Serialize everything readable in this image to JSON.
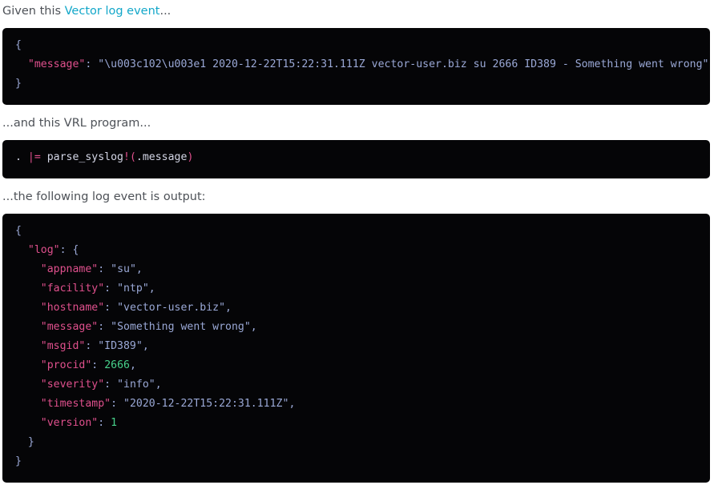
{
  "intro": {
    "prefix": "Given this ",
    "link": "Vector log event",
    "suffix": "..."
  },
  "input_event": {
    "open": "{",
    "key": "\"message\"",
    "colon": ": ",
    "value": "\"\\u003c102\\u003e1 2020-12-22T15:22:31.111Z vector-user.biz su 2666 ID389 - Something went wrong\"",
    "close": "}"
  },
  "program_intro": "...and this VRL program...",
  "program": {
    "target": ". ",
    "operator": "|=",
    "function": " parse_syslog",
    "bang": "!",
    "paren_open": "(",
    "arg": ".message",
    "paren_close": ")"
  },
  "output_intro": "...the following log event is output:",
  "output_event": {
    "open": "{",
    "log_key": "\"log\"",
    "log_open": ": {",
    "fields": [
      {
        "key": "\"appname\"",
        "value": "\"su\"",
        "type": "string",
        "comma": ","
      },
      {
        "key": "\"facility\"",
        "value": "\"ntp\"",
        "type": "string",
        "comma": ","
      },
      {
        "key": "\"hostname\"",
        "value": "\"vector-user.biz\"",
        "type": "string",
        "comma": ","
      },
      {
        "key": "\"message\"",
        "value": "\"Something went wrong\"",
        "type": "string",
        "comma": ","
      },
      {
        "key": "\"msgid\"",
        "value": "\"ID389\"",
        "type": "string",
        "comma": ","
      },
      {
        "key": "\"procid\"",
        "value": "2666",
        "type": "number",
        "comma": ","
      },
      {
        "key": "\"severity\"",
        "value": "\"info\"",
        "type": "string",
        "comma": ","
      },
      {
        "key": "\"timestamp\"",
        "value": "\"2020-12-22T15:22:31.111Z\"",
        "type": "string",
        "comma": ","
      },
      {
        "key": "\"version\"",
        "value": "1",
        "type": "number",
        "comma": ""
      }
    ],
    "log_close": "}",
    "close": "}"
  },
  "colors": {
    "link": "#12a7c9",
    "code_bg": "#050507",
    "key": "#e0508d",
    "string": "#9aa8d6",
    "number": "#47d18b"
  }
}
